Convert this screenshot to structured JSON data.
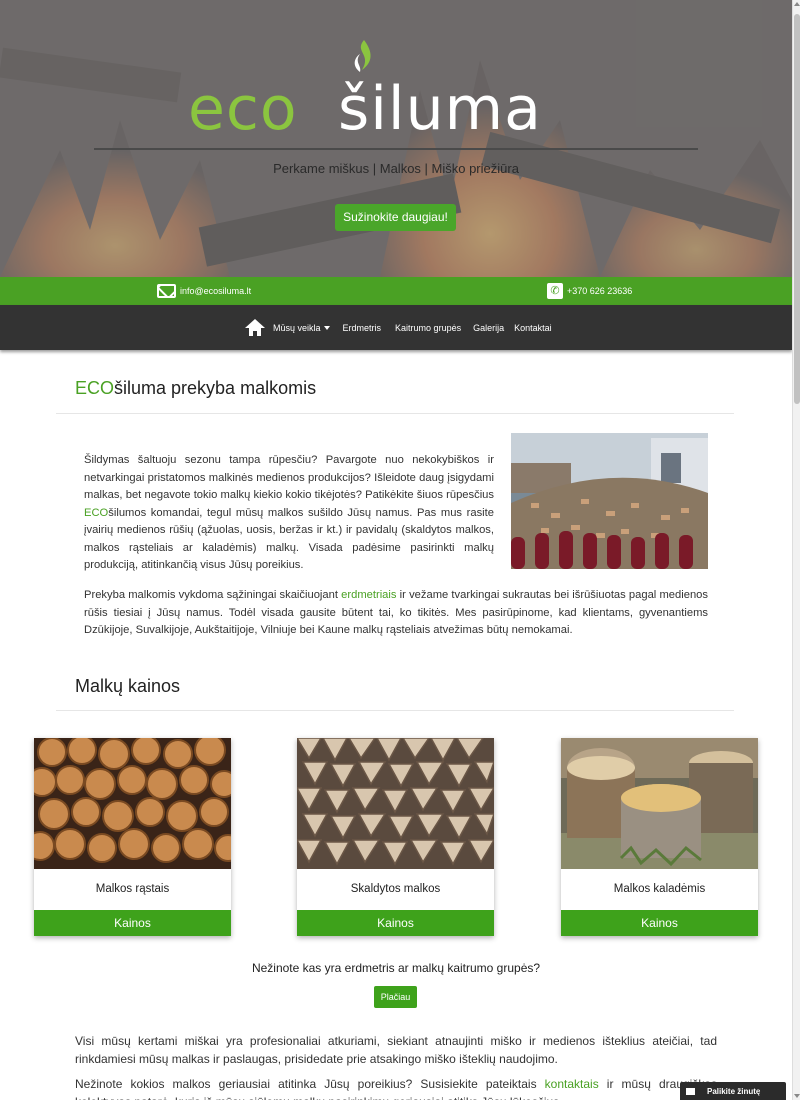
{
  "hero": {
    "logo_eco": "eco",
    "logo_siluma": "šiluma",
    "subtitle": "Perkame miškus | Malkos | Miško priežiūra",
    "cta_label": "Sužinokite daugiau!"
  },
  "contact": {
    "email": "info@ecosiluma.lt",
    "phone": "+370 626 23636"
  },
  "nav": {
    "items": [
      {
        "label": "Mūsų veikla",
        "dropdown": true
      },
      {
        "label": "Erdmetris"
      },
      {
        "label": "Kaitrumo grupės"
      },
      {
        "label": "Galerija"
      },
      {
        "label": "Kontaktai"
      }
    ]
  },
  "intro": {
    "title_eco": "ECO",
    "title_rest": "šiluma prekyba malkomis",
    "p1_a": "Šildymas šaltuoju sezonu tampa rūpesčiu? Pavargote nuo nekokybiškos ir netvarkingai pristatomos malkinės medienos produkcijos? Išleidote daug įsigydami malkas, bet negavote tokio malkų kiekio kokio tikėjotės? Patikėkite šiuos rūpesčius ",
    "p1_eco": "ECO",
    "p1_b": "šilumos komandai, tegul mūsų malkos sušildo Jūsų namus. Pas mus rasite įvairių medienos rūšių (ąžuolas, uosis, beržas ir kt.) ir pavidalų (skaldytos malkos, malkos rąsteliais ar kaladėmis) malkų. Visada padėsime pasirinkti malkų produkciją, atitinkančią visus Jūsų poreikius.",
    "p2_a": "Prekyba malkomis vykdoma sąžiningai skaičiuojant ",
    "p2_link": "erdmetriais",
    "p2_b": " ir vežame tvarkingai sukrautas bei išrūšiuotas pagal medienos rūšis tiesiai į Jūsų namus. Todėl visada gausite būtent tai, ko tikitės. Mes pasirūpinome, kad klientams, gyvenantiems Dzūkijoje, Suvalkijoje, Aukštaitijoje, Vilniuje bei Kaune malkų rąsteliais atvežimas būtų nemokamai."
  },
  "prices": {
    "title": "Malkų kainos",
    "cards": [
      {
        "title": "Malkos rąstais",
        "button": "Kainos"
      },
      {
        "title": "Skaldytos malkos",
        "button": "Kainos"
      },
      {
        "title": "Malkos kaladėmis",
        "button": "Kainos"
      }
    ],
    "question": "Nežinote kas yra erdmetris ar malkų kaitrumo grupės?",
    "more_label": "Plačiau"
  },
  "footer_text": {
    "p3": "Visi mūsų kertami miškai yra profesionaliai atkuriami, siekiant atnaujinti miško ir medienos išteklius ateičiai, tad rinkdamiesi mūsų malkas ir paslaugas, prisidedate prie atsakingo miško išteklių naudojimo.",
    "p4_a": "Nežinote kokios malkos geriausiai atitinka Jūsų poreikius? Susisiekite pateiktais ",
    "p4_link": "kontaktais",
    "p4_b": " ir mūsų draugiškas kolektyvas patarė, kuris iš mūsų siūlomų malkų pasirinkimų geriausiai atitiks Jūsų lūkesčius."
  },
  "chat": {
    "label": "Palikite žinutę"
  },
  "colors": {
    "accent": "#4aa124",
    "nav_bg": "#333333",
    "logo_green": "#8bc53f"
  }
}
